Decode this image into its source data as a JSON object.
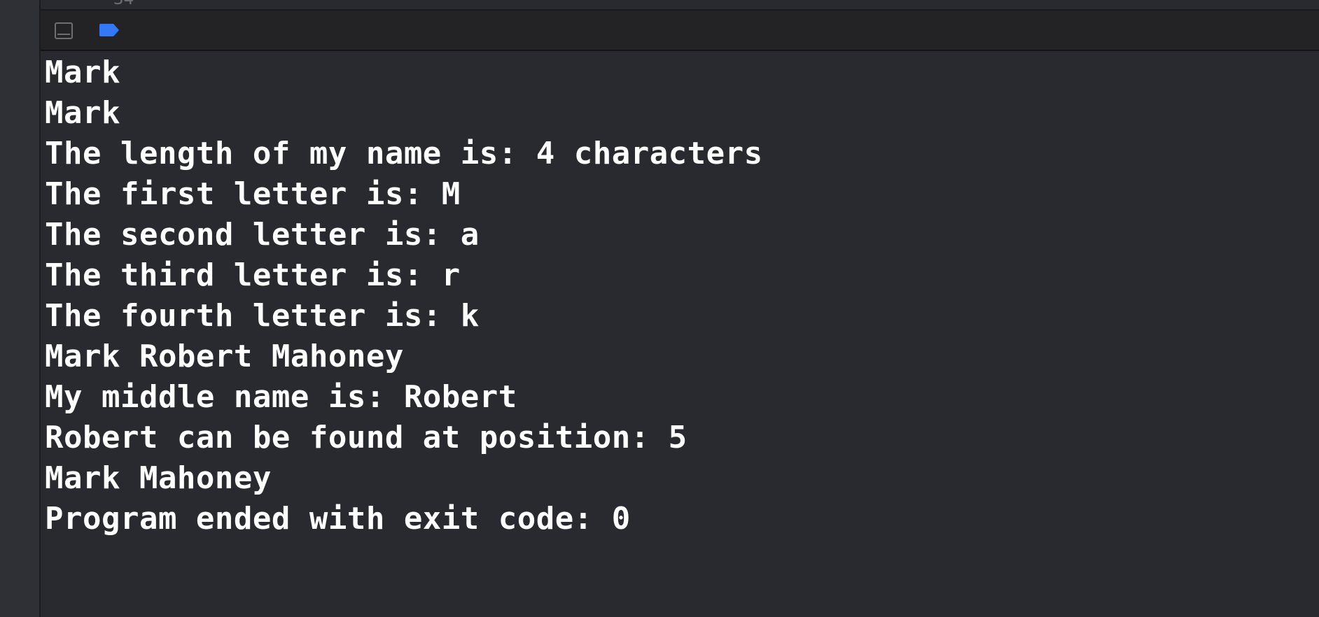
{
  "editor": {
    "partial_line_number": "34"
  },
  "debug_bar": {
    "hide_button": "hide-debug-area",
    "breakpoint_color": "#3478f6"
  },
  "console": {
    "lines": [
      "Mark",
      "Mark",
      "The length of my name is: 4 characters",
      "The first letter is: M",
      "The second letter is: a",
      "The third letter is: r",
      "The fourth letter is: k",
      "Mark Robert Mahoney",
      "My middle name is: Robert",
      "Robert can be found at position: 5",
      "Mark Mahoney",
      "Program ended with exit code: 0"
    ]
  }
}
